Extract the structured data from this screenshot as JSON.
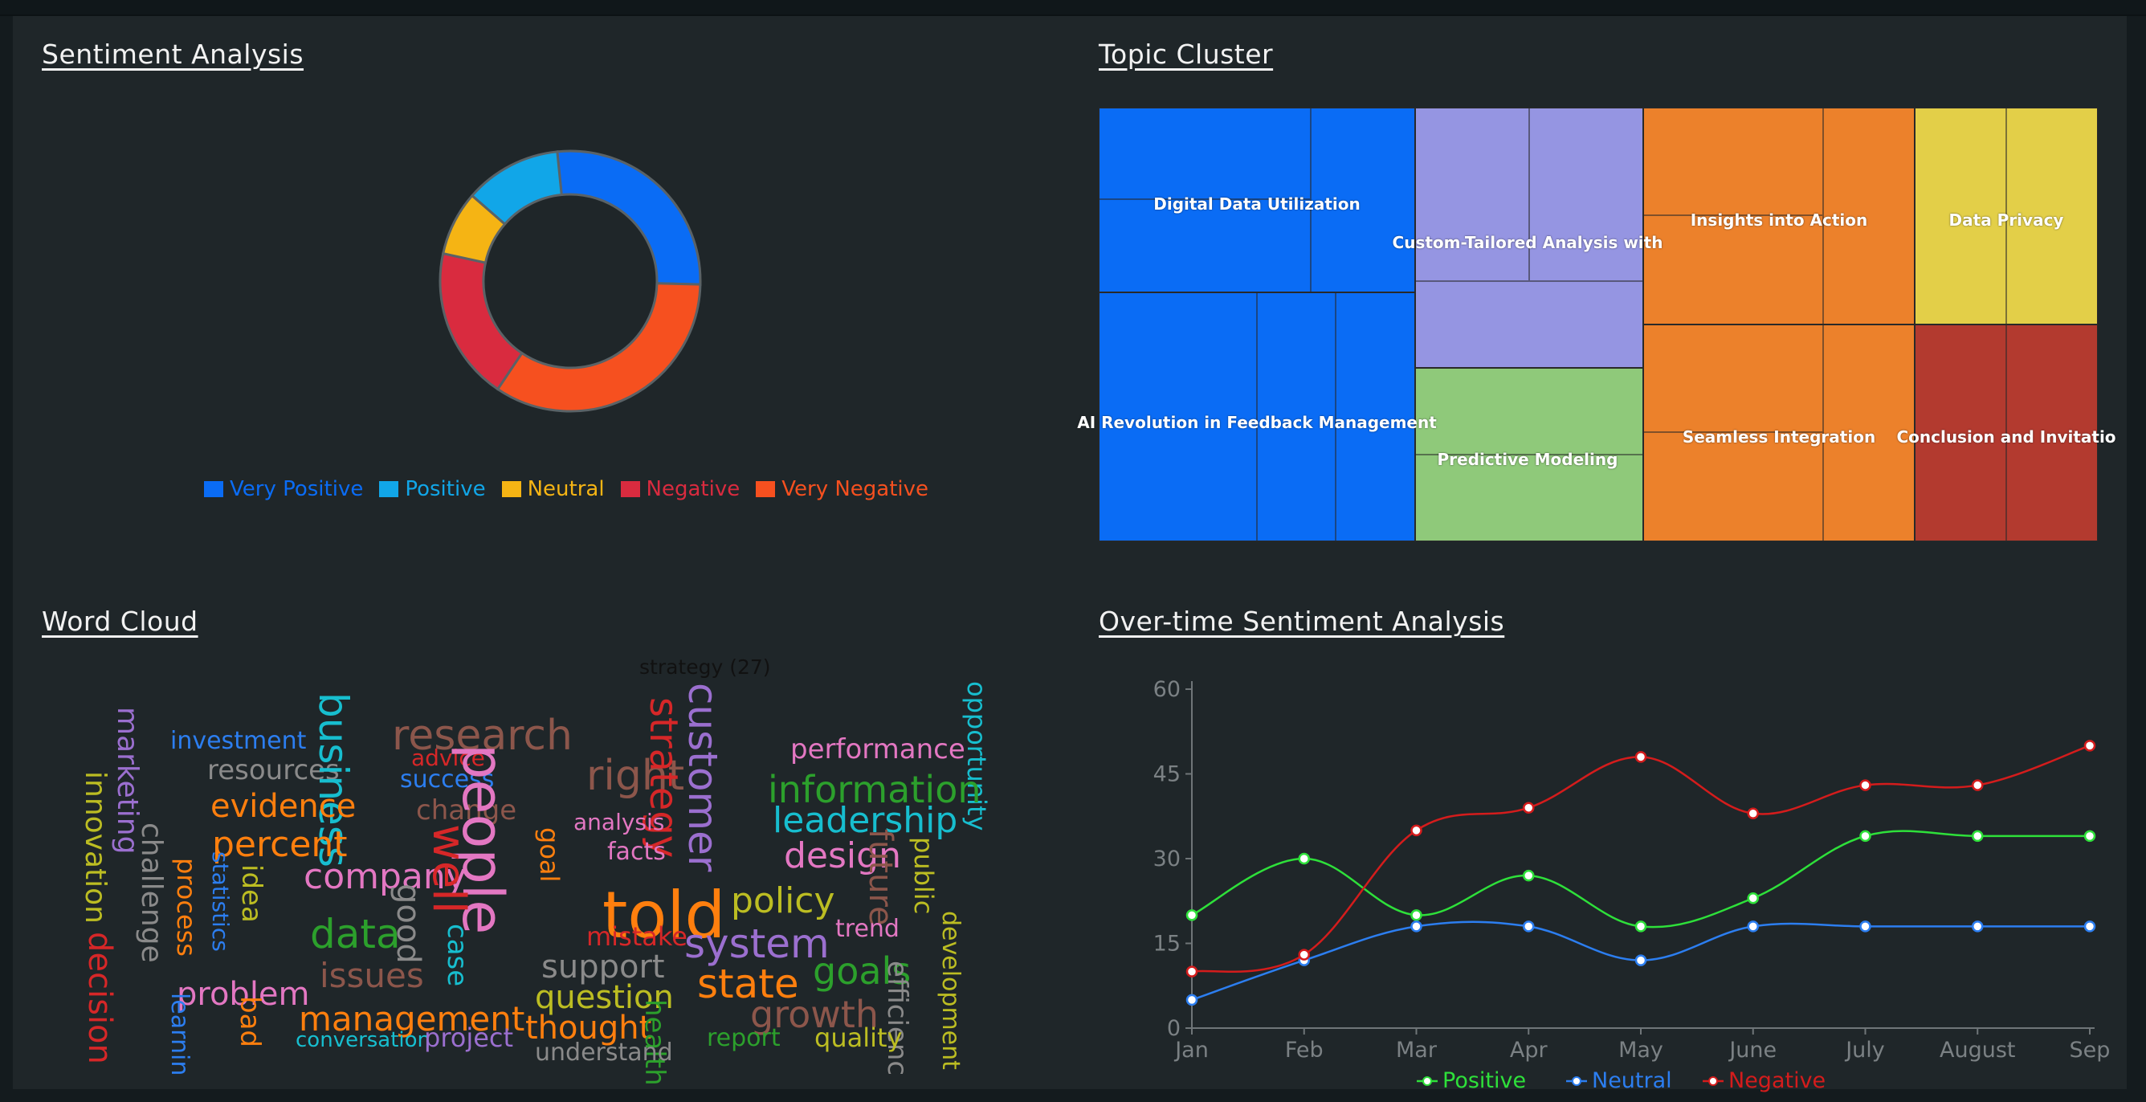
{
  "sections": {
    "sentiment": "Sentiment Analysis",
    "topic": "Topic Cluster",
    "wordcloud": "Word Cloud",
    "overtime": "Over-time Sentiment Analysis"
  },
  "colors": {
    "very_positive": "#0a6cf5",
    "positive": "#11a6e8",
    "neutral": "#f5b414",
    "negative": "#d92b3f",
    "very_negative": "#f6501f",
    "line_positive": "#2ee03a",
    "line_neutral": "#2c7ef0",
    "line_negative": "#d41c1c"
  },
  "chart_data": [
    {
      "type": "pie",
      "title": "Sentiment Analysis",
      "categories": [
        "Very Positive",
        "Positive",
        "Neutral",
        "Negative",
        "Very Negative"
      ],
      "values": [
        27,
        12,
        8,
        19,
        34
      ]
    },
    {
      "type": "heatmap",
      "title": "Topic Cluster",
      "groups": [
        {
          "label": "Digital Data Utilization",
          "color": "#0a6cf5"
        },
        {
          "label": "AI Revolution in Feedback Management",
          "color": "#0a6cf5"
        },
        {
          "label": "Custom-Tailored Analysis with",
          "color": "#9595e2"
        },
        {
          "label": "Predictive Modeling",
          "color": "#8fc97a"
        },
        {
          "label": "Insights into Action",
          "color": "#ec812b"
        },
        {
          "label": "Seamless Integration",
          "color": "#ec812b"
        },
        {
          "label": "Data Privacy",
          "color": "#e3cf48"
        },
        {
          "label": "Conclusion and Invitatio",
          "color": "#b33a2f"
        }
      ]
    },
    {
      "type": "table",
      "title": "Word Cloud",
      "tooltip": "strategy (27)",
      "words": [
        {
          "text": "marketing",
          "color": "#9b6fcf"
        },
        {
          "text": "investment",
          "color": "#2c7ef0"
        },
        {
          "text": "resources",
          "color": "#8a8a8a"
        },
        {
          "text": "business",
          "color": "#17becf"
        },
        {
          "text": "research",
          "color": "#8c564b"
        },
        {
          "text": "advice",
          "color": "#d62728"
        },
        {
          "text": "success",
          "color": "#2c7ef0"
        },
        {
          "text": "change",
          "color": "#8c564b"
        },
        {
          "text": "people",
          "color": "#e377c2"
        },
        {
          "text": "right",
          "color": "#8c564b"
        },
        {
          "text": "strategy",
          "color": "#d62728"
        },
        {
          "text": "customer",
          "color": "#9b6fcf"
        },
        {
          "text": "performance",
          "color": "#e377c2"
        },
        {
          "text": "opportunity",
          "color": "#17becf"
        },
        {
          "text": "information",
          "color": "#2ca02c"
        },
        {
          "text": "leadership",
          "color": "#17becf"
        },
        {
          "text": "innovation",
          "color": "#bcbd22"
        },
        {
          "text": "evidence",
          "color": "#ff7f0e"
        },
        {
          "text": "percent",
          "color": "#ff7f0e"
        },
        {
          "text": "challenge",
          "color": "#8a8a8a"
        },
        {
          "text": "process",
          "color": "#ff7f0e"
        },
        {
          "text": "statistics",
          "color": "#2c7ef0"
        },
        {
          "text": "idea",
          "color": "#bcbd22"
        },
        {
          "text": "company",
          "color": "#e377c2"
        },
        {
          "text": "well",
          "color": "#d62728"
        },
        {
          "text": "goal",
          "color": "#ff7f0e"
        },
        {
          "text": "analysis",
          "color": "#e377c2"
        },
        {
          "text": "facts",
          "color": "#e377c2"
        },
        {
          "text": "told",
          "color": "#ff7f0e"
        },
        {
          "text": "design",
          "color": "#e377c2"
        },
        {
          "text": "future",
          "color": "#8c564b"
        },
        {
          "text": "public",
          "color": "#bcbd22"
        },
        {
          "text": "policy",
          "color": "#bcbd22"
        },
        {
          "text": "data",
          "color": "#2ca02c"
        },
        {
          "text": "good",
          "color": "#8a8a8a"
        },
        {
          "text": "mistake",
          "color": "#d62728"
        },
        {
          "text": "trend",
          "color": "#e377c2"
        },
        {
          "text": "system",
          "color": "#9b6fcf"
        },
        {
          "text": "development",
          "color": "#bcbd22"
        },
        {
          "text": "decision",
          "color": "#d62728"
        },
        {
          "text": "issues",
          "color": "#8c564b"
        },
        {
          "text": "case",
          "color": "#17becf"
        },
        {
          "text": "support",
          "color": "#8a8a8a"
        },
        {
          "text": "goals",
          "color": "#2ca02c"
        },
        {
          "text": "state",
          "color": "#ff7f0e"
        },
        {
          "text": "problem",
          "color": "#e377c2"
        },
        {
          "text": "question",
          "color": "#bcbd22"
        },
        {
          "text": "efficienc",
          "color": "#8a8a8a"
        },
        {
          "text": "learnin",
          "color": "#2c7ef0"
        },
        {
          "text": "bad",
          "color": "#ff7f0e"
        },
        {
          "text": "management",
          "color": "#ff7f0e"
        },
        {
          "text": "growth",
          "color": "#8c564b"
        },
        {
          "text": "thought",
          "color": "#ff7f0e"
        },
        {
          "text": "health",
          "color": "#2ca02c"
        },
        {
          "text": "conversation",
          "color": "#17becf"
        },
        {
          "text": "project",
          "color": "#9b6fcf"
        },
        {
          "text": "understand",
          "color": "#8a8a8a"
        },
        {
          "text": "report",
          "color": "#2ca02c"
        },
        {
          "text": "quality",
          "color": "#bcbd22"
        }
      ]
    },
    {
      "type": "line",
      "title": "Over-time Sentiment Analysis",
      "categories": [
        "Jan",
        "Feb",
        "Mar",
        "Apr",
        "May",
        "June",
        "July",
        "August",
        "Sep"
      ],
      "ylim": [
        0,
        60
      ],
      "yticks": [
        0,
        15,
        30,
        45,
        60
      ],
      "series": [
        {
          "name": "Positive",
          "values": [
            20,
            30,
            20,
            27,
            18,
            23,
            34,
            34,
            34
          ]
        },
        {
          "name": "Neutral",
          "values": [
            5,
            12,
            18,
            18,
            12,
            18,
            18,
            18,
            18
          ]
        },
        {
          "name": "Negative",
          "values": [
            10,
            13,
            35,
            39,
            48,
            38,
            43,
            43,
            50
          ]
        }
      ]
    }
  ]
}
